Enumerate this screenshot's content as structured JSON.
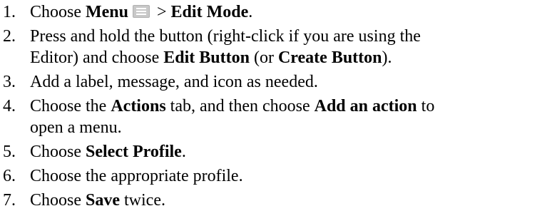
{
  "steps": [
    {
      "num": "1.",
      "p1": "Choose ",
      "b1": "Menu",
      "icon": "menu-icon",
      "p2": " > ",
      "b2": "Edit Mode",
      "p3": "."
    },
    {
      "num": "2.",
      "line1": "Press and hold the button (right-click if you are using the",
      "p1": "Editor) and choose ",
      "b1": "Edit Button",
      "p2": " (or ",
      "b2": "Create Button",
      "p3": ")."
    },
    {
      "num": "3.",
      "text": "Add a label, message, and icon as needed."
    },
    {
      "num": "4.",
      "p1": "Choose the ",
      "b1": "Actions",
      "p2": " tab, and then choose ",
      "b2": "Add an action",
      "p3": " to",
      "line2": "open a menu."
    },
    {
      "num": "5.",
      "p1": "Choose ",
      "b1": "Select Profile",
      "p2": "."
    },
    {
      "num": "6.",
      "text": "Choose the appropriate profile."
    },
    {
      "num": "7.",
      "p1": "Choose ",
      "b1": "Save",
      "p2": " twice."
    }
  ]
}
